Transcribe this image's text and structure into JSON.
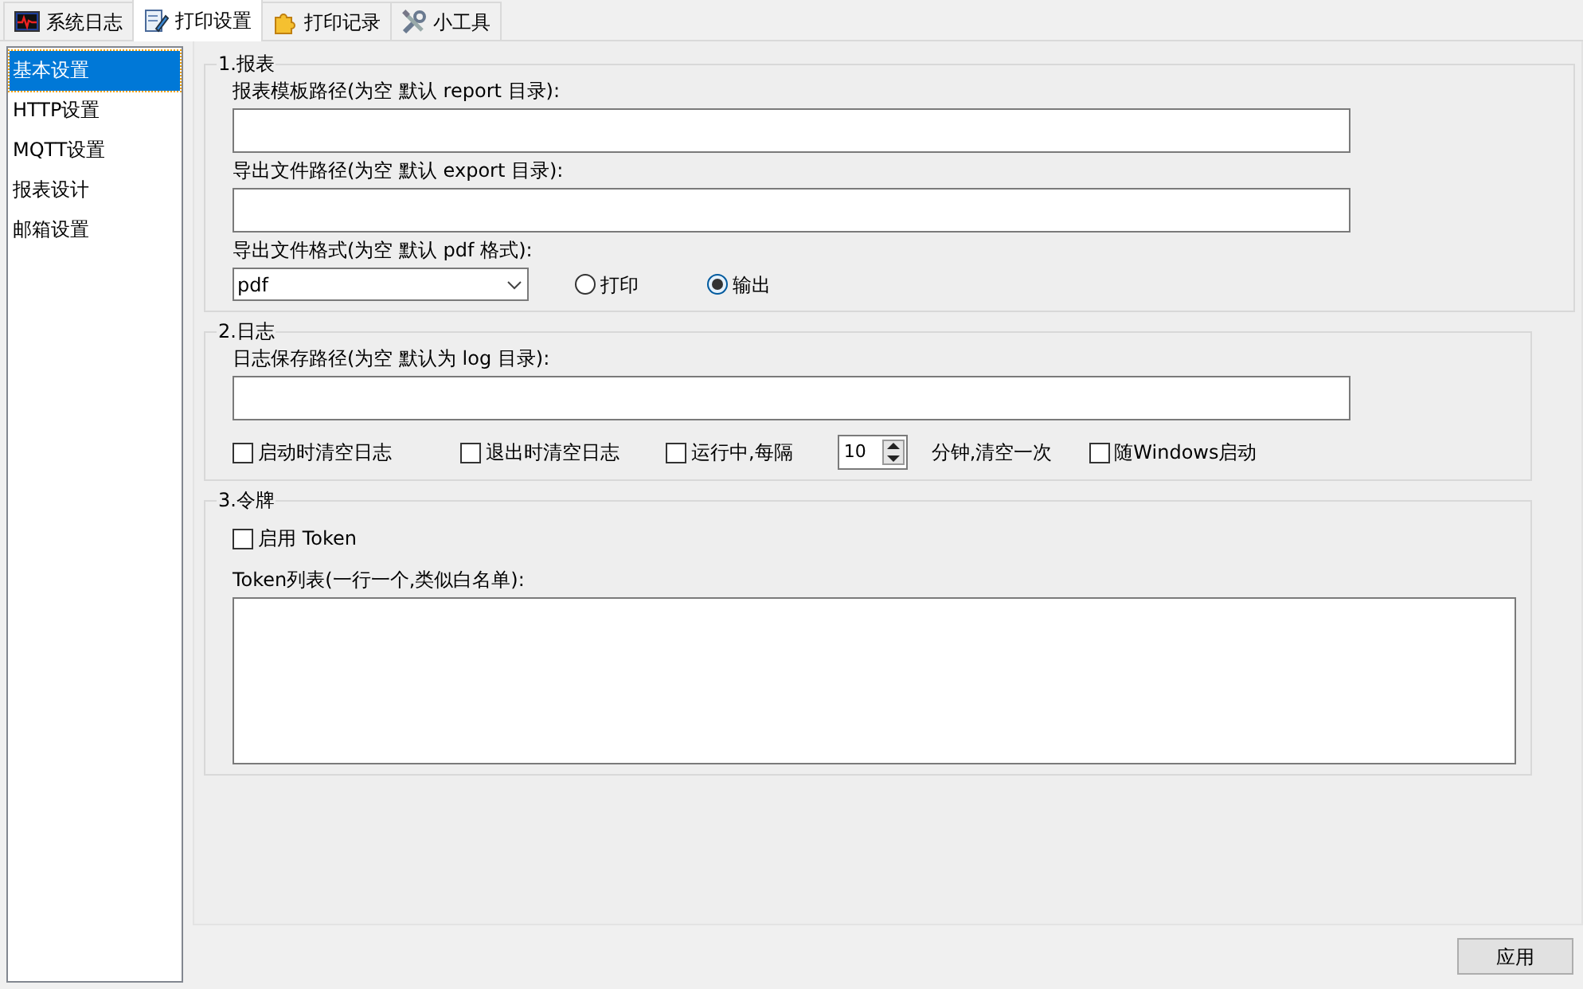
{
  "tabs": [
    {
      "label": "系统日志",
      "selected": false,
      "kind": "monitor"
    },
    {
      "label": "打印设置",
      "selected": true,
      "kind": "document"
    },
    {
      "label": "打印记录",
      "selected": false,
      "kind": "puzzle"
    },
    {
      "label": "小工具",
      "selected": false,
      "kind": "tools"
    }
  ],
  "sidebar": {
    "items": [
      {
        "label": "基本设置",
        "selected": true
      },
      {
        "label": "HTTP设置",
        "selected": false
      },
      {
        "label": "MQTT设置",
        "selected": false
      },
      {
        "label": "报表设计",
        "selected": false
      },
      {
        "label": "邮箱设置",
        "selected": false
      }
    ]
  },
  "report": {
    "title": "1.报表",
    "template_label": "报表模板路径(为空 默认 report 目录):",
    "export_label": "导出文件路径(为空 默认 export 目录):",
    "format_label": "导出文件格式(为空 默认 pdf 格式):",
    "format_value": "pdf",
    "modes": [
      {
        "label": "打印",
        "selected": false
      },
      {
        "label": "输出",
        "selected": true
      }
    ]
  },
  "log": {
    "title": "2.日志",
    "path_label": "日志保存路径(为空 默认为 log 目录):",
    "options": [
      {
        "kind": "checkbox",
        "label": "启动时清空日志",
        "checked": false
      },
      {
        "kind": "checkbox",
        "label": "退出时清空日志",
        "checked": false
      },
      {
        "kind": "interval",
        "label": "运行中,每隔",
        "checked": false,
        "value": "10",
        "suffix": "分钟,清空一次"
      },
      {
        "kind": "checkbox",
        "label": "随Windows启动",
        "checked": false
      }
    ]
  },
  "token": {
    "title": "3.令牌",
    "enable": {
      "label": "启用 Token",
      "checked": false
    },
    "list_label": "Token列表(一行一个,类似白名单):"
  },
  "apply_button": "应用"
}
